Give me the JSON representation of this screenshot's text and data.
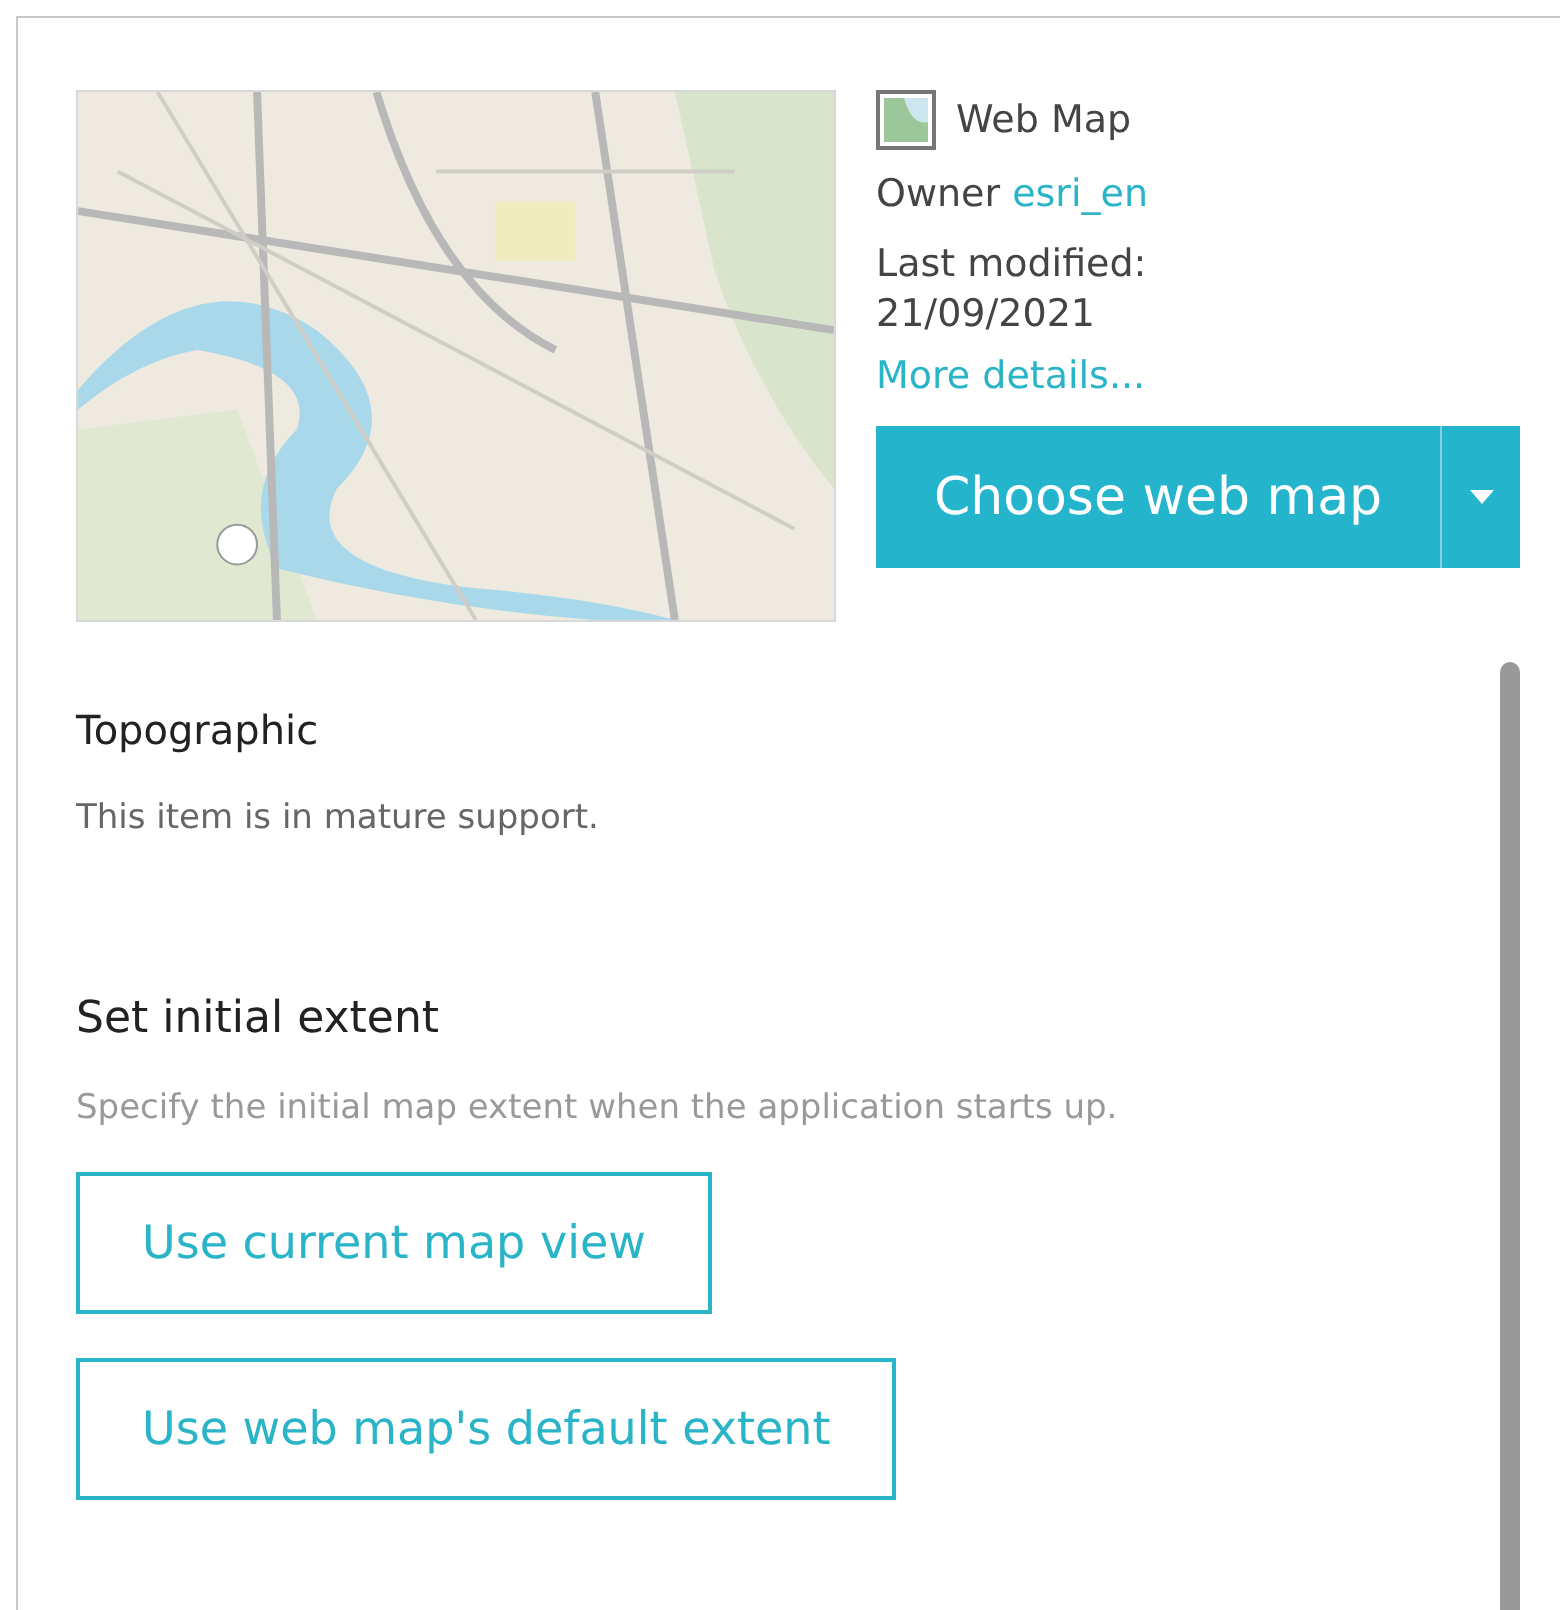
{
  "item": {
    "type": "Web Map",
    "owner_label": "Owner",
    "owner": "esri_en",
    "modified_label": "Last modified:",
    "modified_date": "21/09/2021",
    "details_link": "More details...",
    "choose_button": "Choose web map"
  },
  "name": "Topographic",
  "note": "This item is in mature support.",
  "extent": {
    "heading": "Set initial extent",
    "description": "Specify the initial map extent when the application starts up.",
    "buttons": [
      "Use current map view",
      "Use web map's default extent"
    ]
  }
}
